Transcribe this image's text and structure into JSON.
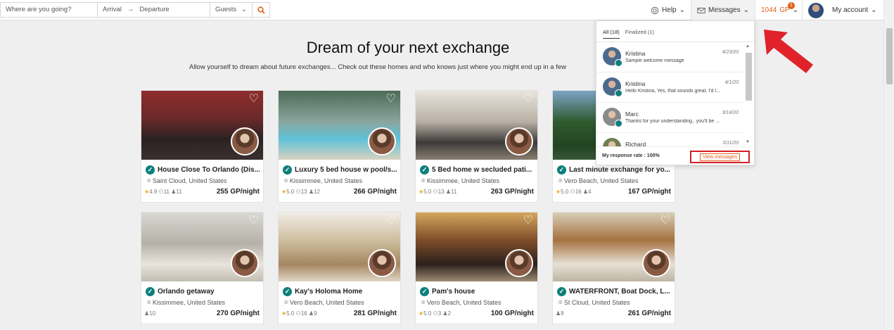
{
  "search": {
    "where_placeholder": "Where are you going?",
    "arrival": "Arrival",
    "arrow": "→",
    "departure": "Departure",
    "guests": "Guests",
    "guests_chevron": "⌄"
  },
  "nav": {
    "help": "Help",
    "messages": "Messages",
    "gp_amount": "1044",
    "gp_label": "GP",
    "gp_badge": "1",
    "account": "My account",
    "chevron": "⌄"
  },
  "hero": {
    "title": "Dream of your next exchange",
    "subtitle": "Allow yourself to dream about future exchanges... Check out these homes and who knows just where you might end up in a few"
  },
  "colors": {
    "accent": "#e0611a",
    "verified": "#0e7f7b",
    "highlight": "#d21f26"
  },
  "listings": [
    {
      "title": "House Close To Orlando (Dis...",
      "location": "Saint Cloud, United States",
      "rating": "4.9",
      "guests": "11",
      "beds": "11",
      "price": "255 GP/night"
    },
    {
      "title": "Luxury 5 bed house w pool/s...",
      "location": "Kissimmee, United States",
      "rating": "5.0",
      "guests": "13",
      "beds": "12",
      "price": "266 GP/night"
    },
    {
      "title": "5 Bed home w secluded pati...",
      "location": "Kissimmee, United States",
      "rating": "5.0",
      "guests": "13",
      "beds": "11",
      "price": "263 GP/night"
    },
    {
      "title": "Last minute exchange for yo...",
      "location": "Vero Beach, United States",
      "rating": "5.0",
      "guests": "16",
      "beds": "4",
      "price": "167 GP/night"
    },
    {
      "title": "Orlando getaway",
      "location": "Kissimmee, United States",
      "rating": "",
      "guests": "",
      "beds": "10",
      "price": "270 GP/night"
    },
    {
      "title": "Kay's Holoma Home",
      "location": "Vero Beach, United States",
      "rating": "5.0",
      "guests": "16",
      "beds": "9",
      "price": "281 GP/night"
    },
    {
      "title": "Pam's house",
      "location": "Vero Beach, United States",
      "rating": "5.0",
      "guests": "3",
      "beds": "2",
      "price": "100 GP/night"
    },
    {
      "title": "WATERFRONT, Boat Dock, L...",
      "location": "St Cloud, United States",
      "rating": "",
      "guests": "",
      "beds": "8",
      "price": "261 GP/night"
    }
  ],
  "messages_dropdown": {
    "tab_all": "All (18)",
    "tab_finalized": "Finalized (1)",
    "items": [
      {
        "name": "Kristina",
        "date": "4/23/20",
        "text": "Sample welcome message"
      },
      {
        "name": "Kristina",
        "date": "4/1/20",
        "text": "Hello Kristina, Yes, that sounds great. I'd l..."
      },
      {
        "name": "Marc",
        "date": "3/14/20",
        "text": "Thanks for your understanding.. you'll be ..."
      },
      {
        "name": "Richard",
        "date": "3/11/20",
        "text": ""
      }
    ],
    "response_rate": "My response rate : 100%",
    "view_button": "View messages"
  }
}
